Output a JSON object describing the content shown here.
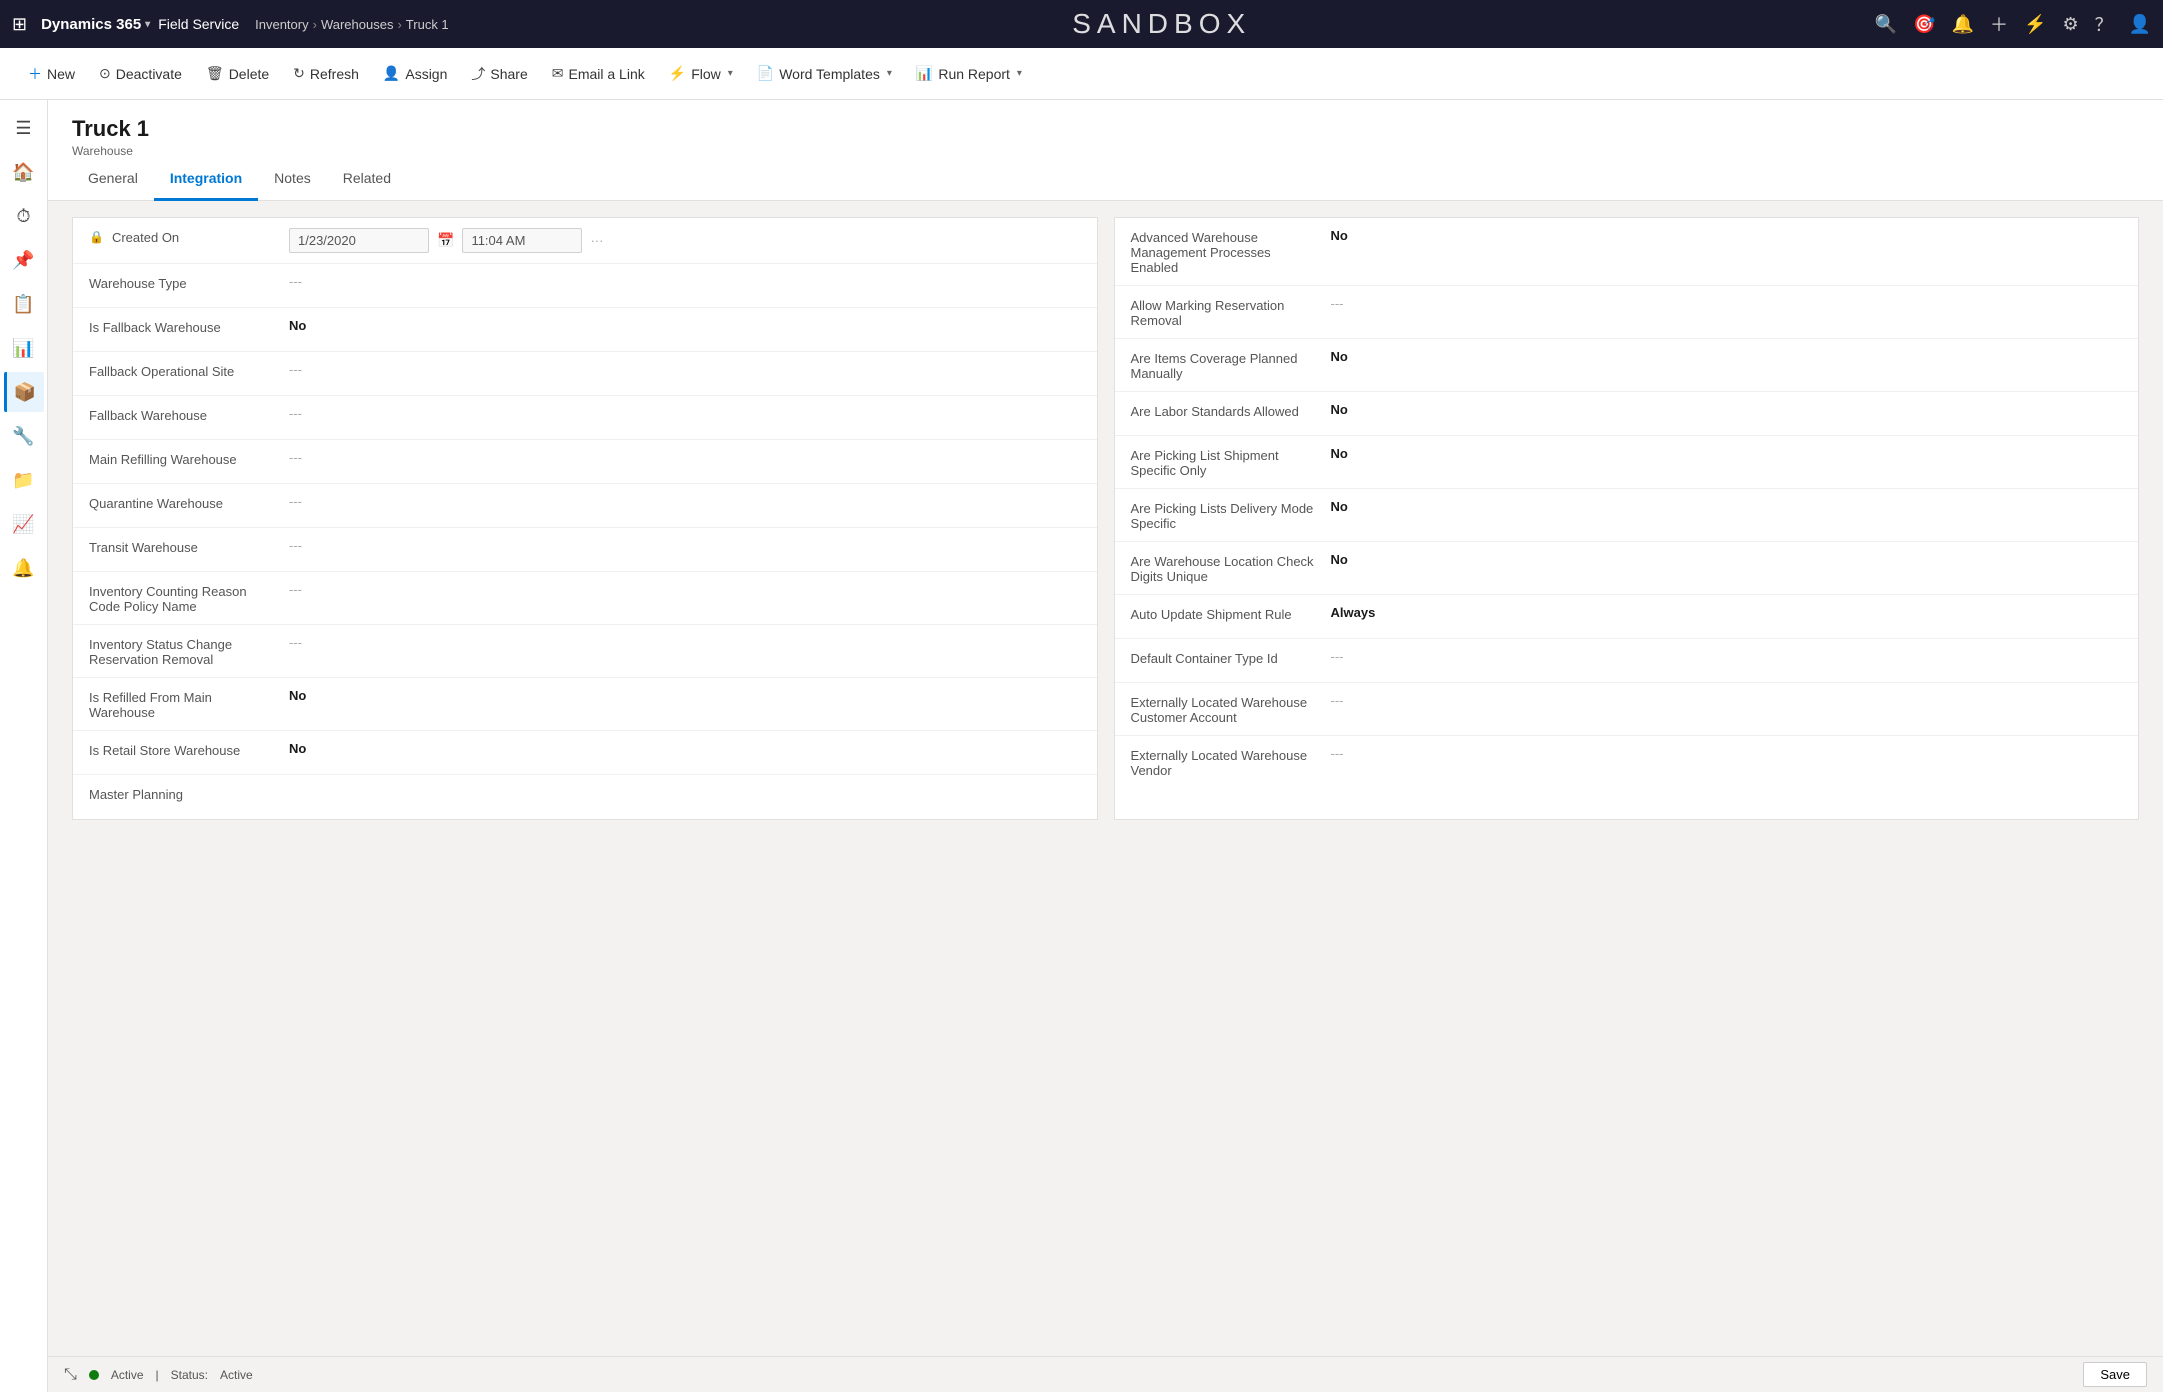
{
  "topNav": {
    "waffle": "⊞",
    "brand": "Dynamics 365",
    "fieldService": "Field Service",
    "breadcrumb": [
      "Inventory",
      "Warehouses",
      "Truck 1"
    ],
    "sandboxTitle": "SANDBOX",
    "icons": [
      "🔍",
      "⊙",
      "♪",
      "+",
      "⚡",
      "⚙",
      "?",
      "👤"
    ]
  },
  "commandBar": {
    "new": "New",
    "deactivate": "Deactivate",
    "delete": "Delete",
    "refresh": "Refresh",
    "assign": "Assign",
    "share": "Share",
    "emailLink": "Email a Link",
    "flow": "Flow",
    "wordTemplates": "Word Templates",
    "runReport": "Run Report"
  },
  "page": {
    "title": "Truck 1",
    "subtitle": "Warehouse"
  },
  "tabs": [
    "General",
    "Integration",
    "Notes",
    "Related"
  ],
  "activeTab": "Integration",
  "leftColumn": [
    {
      "label": "Created On",
      "value": "1/23/2020",
      "time": "11:04 AM",
      "isDate": true,
      "hasLock": true
    },
    {
      "label": "Warehouse Type",
      "value": "---",
      "bold": false
    },
    {
      "label": "Is Fallback Warehouse",
      "value": "No",
      "bold": true
    },
    {
      "label": "Fallback Operational Site",
      "value": "---",
      "bold": false
    },
    {
      "label": "Fallback Warehouse",
      "value": "---",
      "bold": false
    },
    {
      "label": "Main Refilling Warehouse",
      "value": "---",
      "bold": false
    },
    {
      "label": "Quarantine Warehouse",
      "value": "---",
      "bold": false
    },
    {
      "label": "Transit Warehouse",
      "value": "---",
      "bold": false
    },
    {
      "label": "Inventory Counting Reason Code Policy Name",
      "value": "---",
      "bold": false
    },
    {
      "label": "Inventory Status Change Reservation Removal",
      "value": "---",
      "bold": false
    },
    {
      "label": "Is Refilled From Main Warehouse",
      "value": "No",
      "bold": true
    },
    {
      "label": "Is Retail Store Warehouse",
      "value": "No",
      "bold": true
    },
    {
      "label": "Master Planning",
      "value": "",
      "bold": false
    }
  ],
  "rightColumn": [
    {
      "label": "Advanced Warehouse Management Processes Enabled",
      "value": "No",
      "bold": true
    },
    {
      "label": "Allow Marking Reservation Removal",
      "value": "---",
      "bold": false
    },
    {
      "label": "Are Items Coverage Planned Manually",
      "value": "No",
      "bold": true
    },
    {
      "label": "Are Labor Standards Allowed",
      "value": "No",
      "bold": true
    },
    {
      "label": "Are Picking List Shipment Specific Only",
      "value": "No",
      "bold": true
    },
    {
      "label": "Are Picking Lists Delivery Mode Specific",
      "value": "No",
      "bold": true
    },
    {
      "label": "Are Warehouse Location Check Digits Unique",
      "value": "No",
      "bold": true
    },
    {
      "label": "Auto Update Shipment Rule",
      "value": "Always",
      "bold": true
    },
    {
      "label": "Default Container Type Id",
      "value": "---",
      "bold": false
    },
    {
      "label": "Externally Located Warehouse Customer Account",
      "value": "---",
      "bold": false
    },
    {
      "label": "Externally Located Warehouse Vendor",
      "value": "---",
      "bold": false
    }
  ],
  "statusBar": {
    "indicator": "Active",
    "statusLabel": "Status:",
    "statusValue": "Active",
    "saveLabel": "Save"
  },
  "sidebar": {
    "items": [
      {
        "icon": "🏠",
        "name": "home"
      },
      {
        "icon": "⏱",
        "name": "recent"
      },
      {
        "icon": "📌",
        "name": "pinned"
      },
      {
        "icon": "📋",
        "name": "tasks"
      },
      {
        "icon": "📊",
        "name": "dashboards"
      },
      {
        "icon": "📦",
        "name": "inventory",
        "active": true
      },
      {
        "icon": "🔧",
        "name": "tools"
      },
      {
        "icon": "📁",
        "name": "files"
      },
      {
        "icon": "📈",
        "name": "reports"
      },
      {
        "icon": "🔔",
        "name": "notifications"
      }
    ]
  }
}
